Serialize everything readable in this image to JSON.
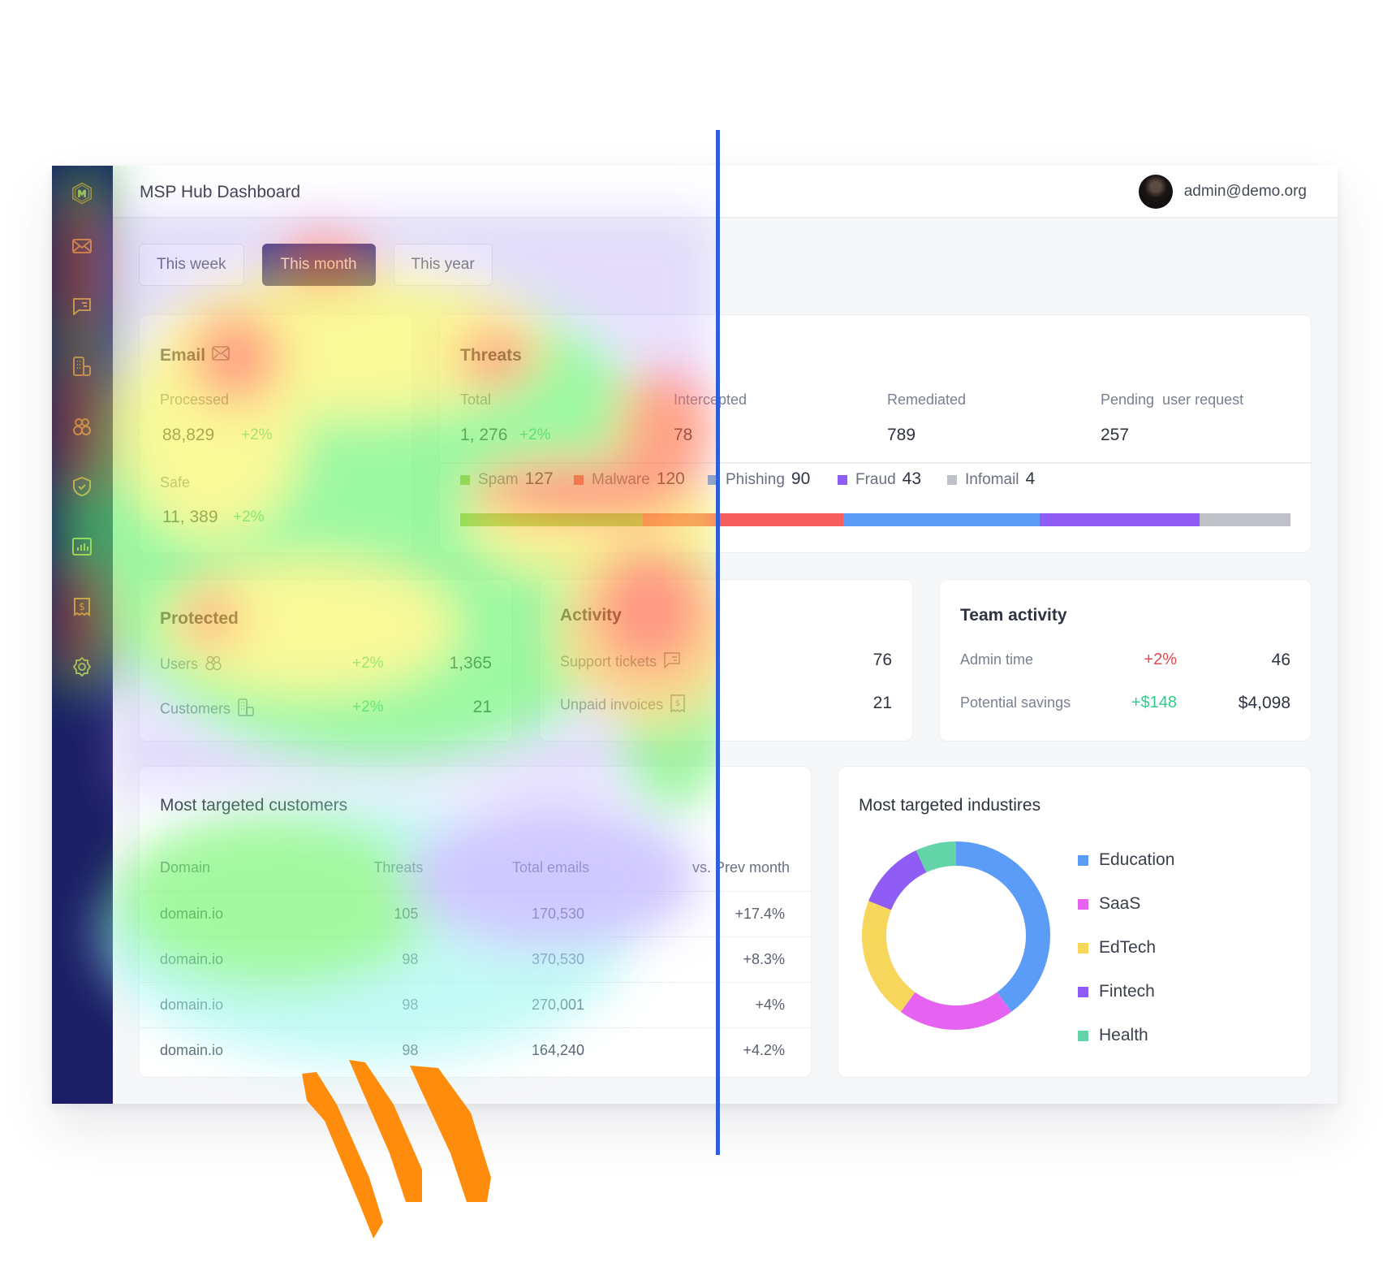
{
  "header": {
    "title": "MSP Hub Dashboard",
    "user_email": "admin@demo.org"
  },
  "sidebar": {
    "items": [
      {
        "icon": "mail-icon",
        "name": "sidebar-item-email"
      },
      {
        "icon": "chat-icon",
        "name": "sidebar-item-messages"
      },
      {
        "icon": "building-icon",
        "name": "sidebar-item-customers"
      },
      {
        "icon": "users-icon",
        "name": "sidebar-item-users"
      },
      {
        "icon": "shield-check-icon",
        "name": "sidebar-item-security"
      },
      {
        "icon": "bar-chart-icon",
        "name": "sidebar-item-reports"
      },
      {
        "icon": "invoice-icon",
        "name": "sidebar-item-billing"
      },
      {
        "icon": "gear-icon",
        "name": "sidebar-item-settings"
      }
    ]
  },
  "tabs": [
    {
      "label": "This week",
      "active": false
    },
    {
      "label": "This month",
      "active": true
    },
    {
      "label": "This year",
      "active": false
    }
  ],
  "email": {
    "title": "Email",
    "processed_label": "Processed",
    "processed_value": "88,829",
    "processed_change": "+2%",
    "safe_label": "Safe",
    "safe_value": "11, 389",
    "safe_change": "+2%"
  },
  "threats": {
    "title": "Threats",
    "total_label": "Total",
    "total_value": "1, 276",
    "total_change": "+2%",
    "intercepted_label": "Intercepted",
    "intercepted_value": "78",
    "remediated_label": "Remediated",
    "remediated_value": "789",
    "pending_label": "Pending  user request",
    "pending_value": "257",
    "breakdown": [
      {
        "label": "Spam",
        "value": 127,
        "color": "#8bc34a"
      },
      {
        "label": "Malware",
        "value": 120,
        "color": "#f75f5f"
      },
      {
        "label": "Phishing",
        "value": 90,
        "color": "#5b9cf6"
      },
      {
        "label": "Fraud",
        "value": 43,
        "color": "#8f5cf5"
      },
      {
        "label": "Infomail",
        "value": 4,
        "color": "#bfc1c8"
      }
    ],
    "bar_fractions": [
      0.2,
      0.22,
      0.215,
      0.175,
      0.1
    ]
  },
  "protected": {
    "title": "Protected",
    "users_label": "Users",
    "users_change": "+2%",
    "users_value": "1,365",
    "customers_label": "Customers",
    "customers_change": "+2%",
    "customers_value": "21"
  },
  "activity": {
    "title": "Activity",
    "tickets_label": "Support tickets",
    "tickets_value": "76",
    "invoices_label": "Unpaid invoices",
    "invoices_value": "21"
  },
  "team": {
    "title": "Team activity",
    "admin_label": "Admin time",
    "admin_change": "+2%",
    "admin_value": "46",
    "savings_label": "Potential savings",
    "savings_change": "+$148",
    "savings_value": "$4,098"
  },
  "customers_table": {
    "title": "Most targeted customers",
    "columns": [
      "Domain",
      "Threats",
      "Total emails",
      "vs. Prev month"
    ],
    "rows": [
      {
        "domain": "domain.io",
        "threats": "105",
        "total": "170,530",
        "change": "+17.4%",
        "tone": "red"
      },
      {
        "domain": "domain.io",
        "threats": "98",
        "total": "370,530",
        "change": "+8.3%",
        "tone": "orange"
      },
      {
        "domain": "domain.io",
        "threats": "98",
        "total": "270,001",
        "change": "+4%",
        "tone": "orange"
      },
      {
        "domain": "domain.io",
        "threats": "98",
        "total": "164,240",
        "change": "+4.2%",
        "tone": "orange"
      }
    ]
  },
  "chart_data": {
    "type": "pie",
    "title": "Most targeted industires",
    "categories": [
      "Education",
      "SaaS",
      "EdTech",
      "Fintech",
      "Health"
    ],
    "values": [
      40,
      20,
      21,
      12,
      7
    ],
    "colors": [
      "#5b9cf6",
      "#e563f0",
      "#f7d65c",
      "#8f5cf5",
      "#62d4a8"
    ],
    "donut": true,
    "legend": "right"
  }
}
